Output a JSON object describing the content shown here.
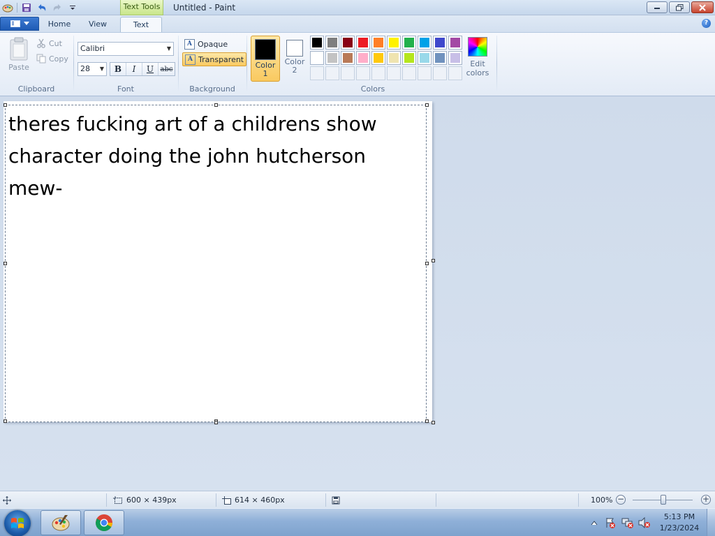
{
  "window": {
    "title": "Untitled - Paint",
    "contextual_tab": "Text Tools"
  },
  "tabs": [
    {
      "label": "Home"
    },
    {
      "label": "View"
    },
    {
      "label": "Text"
    }
  ],
  "clipboard": {
    "paste_label": "Paste",
    "cut_label": "Cut",
    "copy_label": "Copy",
    "group_label": "Clipboard"
  },
  "font": {
    "family": "Calibri",
    "size": "28",
    "bold_label": "B",
    "italic_label": "I",
    "underline_label": "U",
    "strike_label": "abc",
    "group_label": "Font"
  },
  "background": {
    "opaque_label": "Opaque",
    "transparent_label": "Transparent",
    "selected": "Transparent",
    "group_label": "Background"
  },
  "colors": {
    "color1_label": "Color\n1",
    "color2_label": "Color\n2",
    "color1_value": "#000000",
    "color2_value": "#ffffff",
    "edit_label": "Edit colors",
    "group_label": "Colors",
    "palette": [
      "#000000",
      "#7f7f7f",
      "#880015",
      "#ed1c24",
      "#ff7f27",
      "#fff200",
      "#22b14c",
      "#00a2e8",
      "#3f48cc",
      "#a349a4",
      "#ffffff",
      "#c3c3c3",
      "#b97a57",
      "#ffaec9",
      "#ffc90e",
      "#efe4b0",
      "#b5e61d",
      "#99d9ea",
      "#7092be",
      "#c8bfe7"
    ],
    "empty_slots": 10
  },
  "canvas": {
    "text": "theres fucking art of a childrens show\ncharacter doing the john hutcherson\nmew-"
  },
  "status": {
    "selection_size": "600 × 439px",
    "canvas_size": "614 × 460px",
    "zoom": "100%",
    "zoom_percent": 100
  },
  "taskbar": {
    "time": "5:13 PM",
    "date": "1/23/2024"
  }
}
